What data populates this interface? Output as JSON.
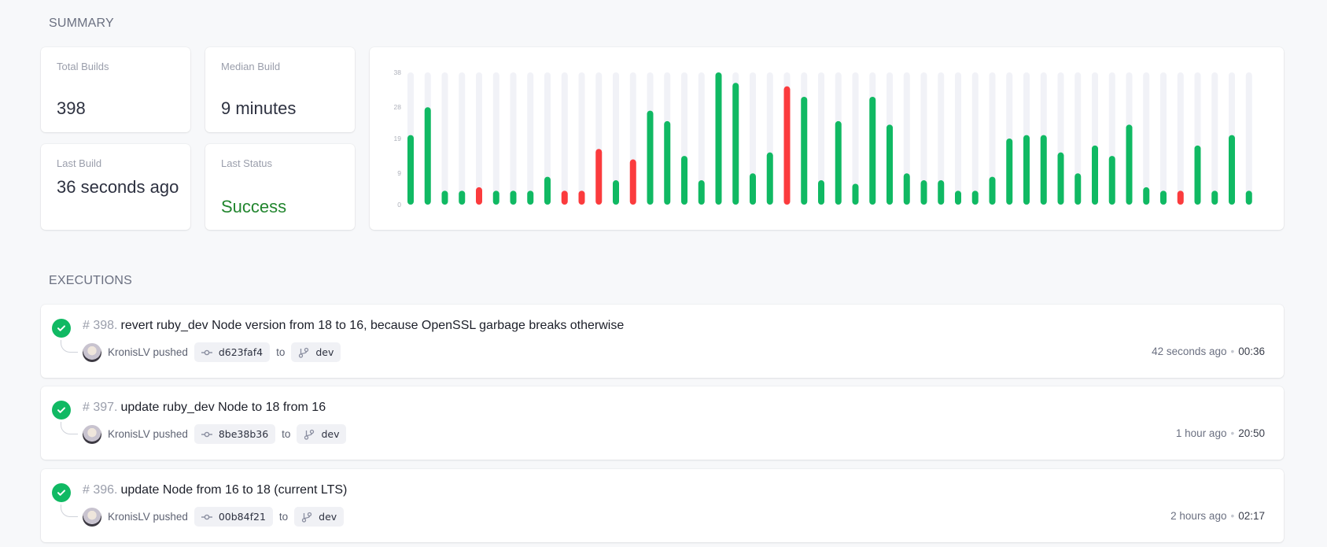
{
  "summary": {
    "heading": "SUMMARY",
    "stats": [
      {
        "label": "Total Builds",
        "value": "398"
      },
      {
        "label": "Median Build",
        "value": "9 minutes"
      },
      {
        "label": "Last Build",
        "value": "36 seconds ago"
      },
      {
        "label": "Last Status",
        "value": "Success"
      }
    ]
  },
  "colors": {
    "success": "#10b963",
    "failure": "#fb3b3d",
    "track": "#f1f2f7",
    "status_success_text": "#22862f"
  },
  "chart_data": {
    "type": "bar",
    "title": "",
    "xlabel": "",
    "ylabel": "",
    "ylim": [
      0,
      38
    ],
    "y_ticks": [
      0,
      9,
      19,
      28,
      38
    ],
    "grid": false,
    "legend": "none",
    "values": [
      20,
      28,
      4,
      4,
      5,
      4,
      4,
      4,
      8,
      4,
      4,
      16,
      7,
      13,
      27,
      24,
      14,
      7,
      38,
      35,
      9,
      15,
      34,
      31,
      7,
      24,
      6,
      31,
      23,
      9,
      7,
      7,
      4,
      4,
      8,
      19,
      20,
      20,
      15,
      9,
      17,
      14,
      23,
      5,
      4,
      4,
      17,
      4,
      20,
      4
    ],
    "status": [
      "success",
      "success",
      "success",
      "success",
      "failure",
      "success",
      "success",
      "success",
      "success",
      "failure",
      "failure",
      "failure",
      "success",
      "failure",
      "success",
      "success",
      "success",
      "success",
      "success",
      "success",
      "success",
      "success",
      "failure",
      "success",
      "success",
      "success",
      "success",
      "success",
      "success",
      "success",
      "success",
      "success",
      "success",
      "success",
      "success",
      "success",
      "success",
      "success",
      "success",
      "success",
      "success",
      "success",
      "success",
      "success",
      "success",
      "failure",
      "success",
      "success",
      "success",
      "success"
    ]
  },
  "executions": {
    "heading": "EXECUTIONS",
    "items": [
      {
        "number": "# 398.",
        "message": "revert ruby_dev Node version from 18 to 16, because OpenSSL garbage breaks otherwise",
        "user": "KronisLV",
        "action": "pushed",
        "commit": "d623faf4",
        "to": "to",
        "branch": "dev",
        "ago": "42 seconds ago",
        "duration": "00:36",
        "status": "success"
      },
      {
        "number": "# 397.",
        "message": "update ruby_dev Node to 18 from 16",
        "user": "KronisLV",
        "action": "pushed",
        "commit": "8be38b36",
        "to": "to",
        "branch": "dev",
        "ago": "1 hour ago",
        "duration": "20:50",
        "status": "success"
      },
      {
        "number": "# 396.",
        "message": "update Node from 16 to 18 (current LTS)",
        "user": "KronisLV",
        "action": "pushed",
        "commit": "00b84f21",
        "to": "to",
        "branch": "dev",
        "ago": "2 hours ago",
        "duration": "02:17",
        "status": "success"
      }
    ]
  }
}
